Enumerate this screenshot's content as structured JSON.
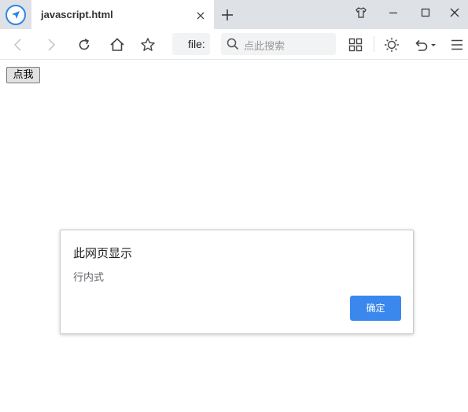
{
  "browser": {
    "tab": {
      "title": "javascript.html"
    },
    "address_bar": {
      "text": "file:"
    },
    "search": {
      "placeholder": "点此搜索"
    }
  },
  "page": {
    "button_label": "点我"
  },
  "dialog": {
    "title": "此网页显示",
    "message": "行内式",
    "ok_label": "确定"
  },
  "colors": {
    "accent": "#3a88ee",
    "titlebar": "#dee1e6"
  }
}
